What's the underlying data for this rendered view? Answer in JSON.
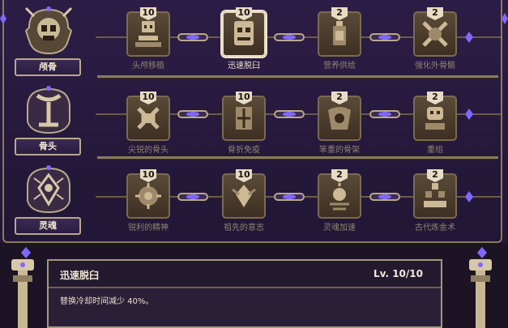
{
  "categories": [
    {
      "label": "颅骨",
      "icon": "skull-icon"
    },
    {
      "label": "骨头",
      "icon": "bone-icon"
    },
    {
      "label": "灵魂",
      "icon": "soul-icon"
    }
  ],
  "skills": [
    [
      {
        "name": "头颅移植",
        "level": "10",
        "icon": "skull-transplant-icon"
      },
      {
        "name": "迅速脱臼",
        "level": "10",
        "icon": "quick-dislocation-icon",
        "selected": true
      },
      {
        "name": "营养供给",
        "level": "2",
        "icon": "nutrition-supply-icon"
      },
      {
        "name": "强化外骨骼",
        "level": "2",
        "icon": "reinforced-exoskeleton-icon"
      }
    ],
    [
      {
        "name": "尖锐的骨头",
        "level": "10",
        "icon": "sharp-bone-icon"
      },
      {
        "name": "骨折免疫",
        "level": "10",
        "icon": "fracture-immunity-icon"
      },
      {
        "name": "笨重的骨架",
        "level": "2",
        "icon": "heavy-skeleton-icon"
      },
      {
        "name": "重组",
        "level": "2",
        "icon": "reassemble-icon"
      }
    ],
    [
      {
        "name": "锐利的精神",
        "level": "10",
        "icon": "keen-spirit-icon"
      },
      {
        "name": "祖先的意志",
        "level": "10",
        "icon": "ancestor-will-icon"
      },
      {
        "name": "灵魂加速",
        "level": "2",
        "icon": "soul-acceleration-icon"
      },
      {
        "name": "古代炼金术",
        "level": "2",
        "icon": "ancient-alchemy-icon"
      }
    ]
  ],
  "detail": {
    "title": "迅速脱臼",
    "level": "Lv. 10/10",
    "description": "替换冷却时间减少 40%。"
  },
  "colors": {
    "accent": "#7f68ff",
    "gold": "#b9a98a",
    "background": "#2a1d40"
  }
}
